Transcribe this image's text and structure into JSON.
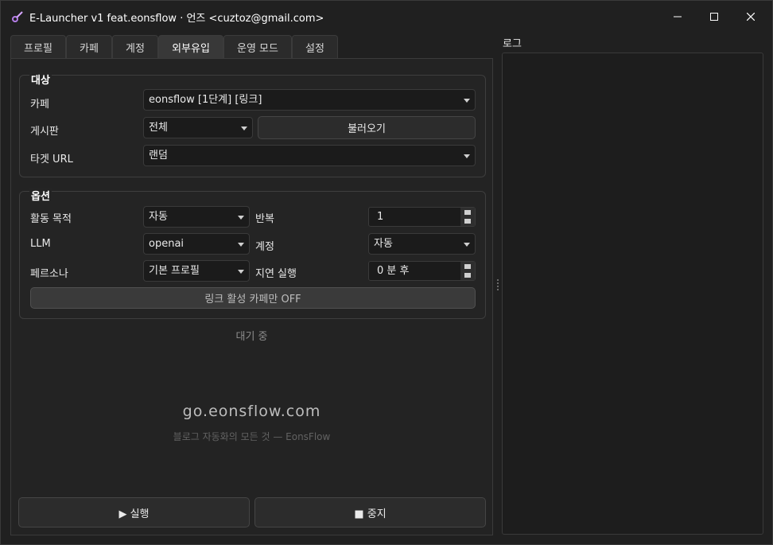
{
  "window": {
    "title": "E-Launcher v1 feat.eonsflow  ·  언즈 <cuztoz@gmail.com>",
    "controls": {
      "minimize": "—",
      "maximize": "☐",
      "close": "✕"
    }
  },
  "tabs": [
    {
      "label": "프로필"
    },
    {
      "label": "카페"
    },
    {
      "label": "계정"
    },
    {
      "label": "외부유입",
      "active": true
    },
    {
      "label": "운영 모드"
    },
    {
      "label": "설정"
    }
  ],
  "target": {
    "title": "대상",
    "cafe_label": "카페",
    "cafe_value": "eonsflow [1단계] [링크]",
    "board_label": "게시판",
    "board_value": "전체",
    "load_button": "불러오기",
    "url_label": "타겟 URL",
    "url_value": "랜덤"
  },
  "options": {
    "title": "옵션",
    "purpose_label": "활동 목적",
    "purpose_value": "자동",
    "repeat_label": "반복",
    "repeat_value": "1",
    "llm_label": "LLM",
    "llm_value": "openai",
    "account_label": "계정",
    "account_value": "자동",
    "persona_label": "페르소나",
    "persona_value": "기본 프로필",
    "delay_label": "지연 실행",
    "delay_value": "0 분 후",
    "toggle_label": "링크 활성 카페만  OFF"
  },
  "status": "대기 중",
  "brand": {
    "url": "go.eonsflow.com",
    "tagline": "블로그 자동화의 모든 것 — EonsFlow"
  },
  "actions": {
    "run": "▶  실행",
    "stop": "■  중지"
  },
  "log": {
    "label": "로그"
  },
  "colors": {
    "background": "#202020",
    "panel": "#232323",
    "accent_icon": "#b57ee8"
  }
}
